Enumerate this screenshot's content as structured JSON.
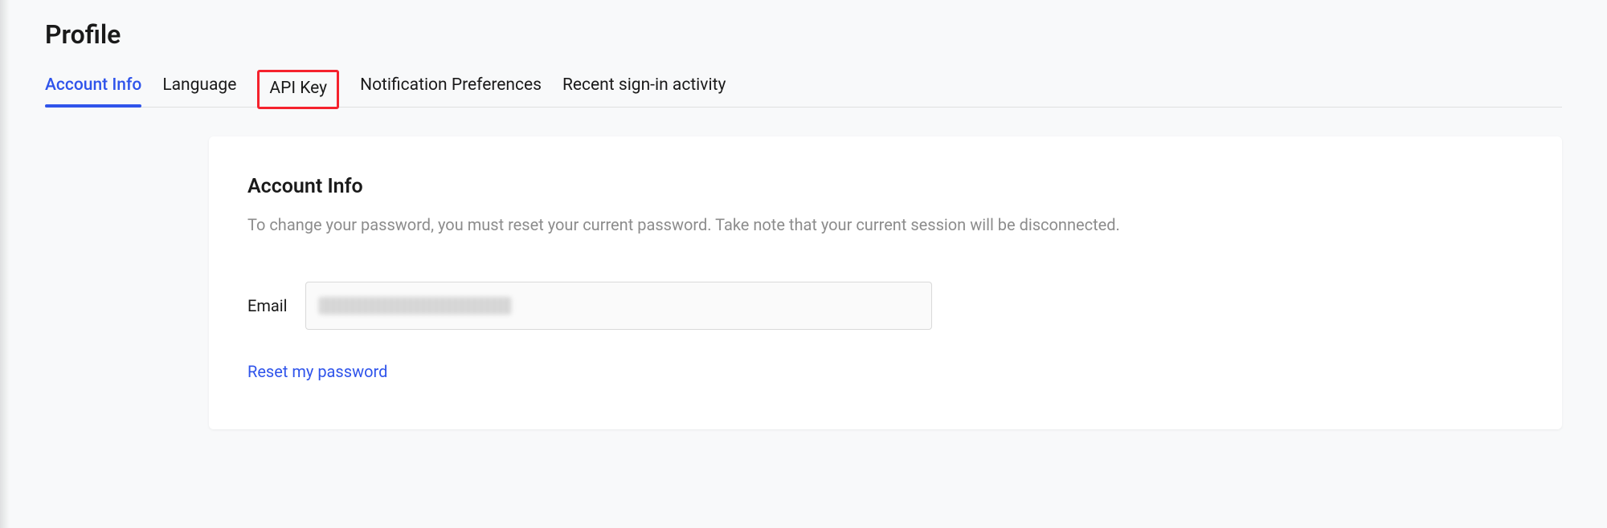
{
  "page": {
    "title": "Profile"
  },
  "tabs": [
    {
      "label": "Account Info",
      "active": true,
      "highlighted": false
    },
    {
      "label": "Language",
      "active": false,
      "highlighted": false
    },
    {
      "label": "API Key",
      "active": false,
      "highlighted": true
    },
    {
      "label": "Notification Preferences",
      "active": false,
      "highlighted": false
    },
    {
      "label": "Recent sign-in activity",
      "active": false,
      "highlighted": false
    }
  ],
  "card": {
    "title": "Account Info",
    "description": "To change your password, you must reset your current password. Take note that your current session will be disconnected.",
    "email_label": "Email",
    "email_value": "",
    "reset_link": "Reset my password"
  },
  "colors": {
    "accent": "#2f54eb",
    "highlight_border": "#f5222d"
  }
}
